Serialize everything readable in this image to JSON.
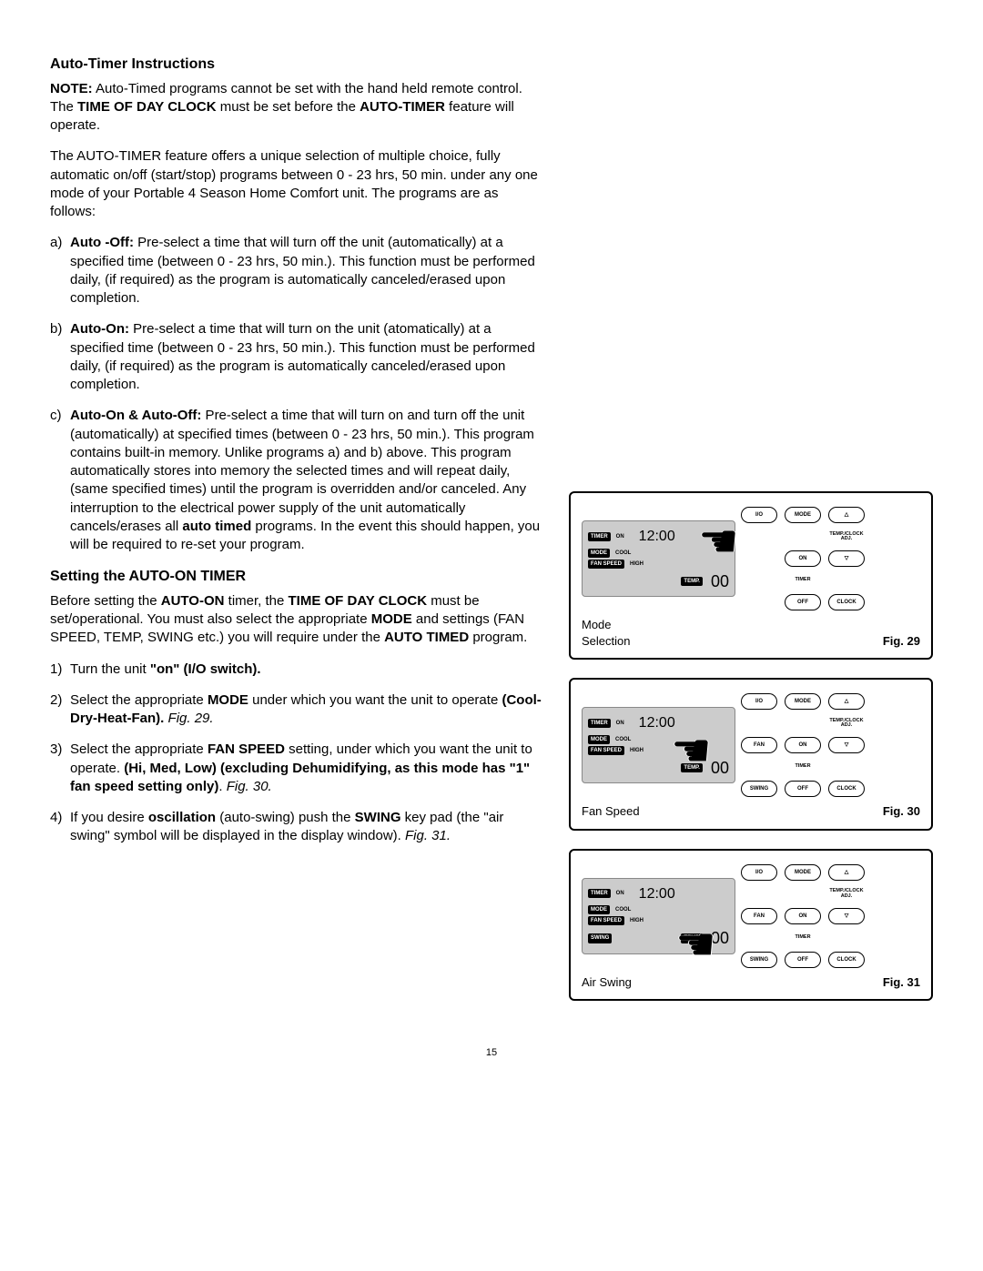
{
  "page_number": "15",
  "section1_title": "Auto-Timer Instructions",
  "note_prefix": "NOTE:",
  "note_text_1": "  Auto-Timed programs cannot be set with the hand held remote control.  The ",
  "note_bold_1": "TIME OF DAY CLOCK",
  "note_text_2": " must be set before the ",
  "note_bold_2": "AUTO-TIMER",
  "note_text_3": " feature will operate.",
  "intro": "The AUTO-TIMER feature offers a unique selection of multiple choice, fully automatic on/off (start/stop) programs between 0 - 23 hrs, 50 min. under any one mode of your Portable 4 Season Home Comfort unit.  The programs are as follows:",
  "a_marker": "a)",
  "a_bold": "Auto -Off:",
  "a_text": "  Pre-select a time that will turn off the unit (automatically) at a specified time (between 0 - 23 hrs, 50 min.).  This function must be performed daily, (if required) as the program is automatically canceled/erased upon completion.",
  "b_marker": "b)",
  "b_bold": "Auto-On:",
  "b_text": "  Pre-select a time that will turn on the unit (atomatically) at a specified time (between 0 - 23 hrs, 50 min.).  This function must be performed daily, (if required) as the program is automatically canceled/erased upon completion.",
  "c_marker": "c)",
  "c_bold_1": "Auto-On & Auto-Off:",
  "c_text_1": "  Pre-select a time that will turn on and turn off the unit (automatically) at specified times (between 0 - 23 hrs, 50 min.).  This program contains built-in memory.  Unlike programs a) and b) above.  This program automatically stores into memory the selected times and will repeat daily, (same specified times) until the program is overridden and/or canceled.  Any interruption to the electrical power supply of the unit automatically cancels/erases all ",
  "c_bold_2": "auto timed",
  "c_text_2": " programs.  In the event this should happen, you will be required to re-set your program.",
  "section2_title": "Setting the AUTO-ON TIMER",
  "s2_p1_1": "Before setting the ",
  "s2_p1_b1": "AUTO-ON",
  "s2_p1_2": " timer, the ",
  "s2_p1_b2": "TIME OF DAY CLOCK",
  "s2_p1_3": " must be set/operational.  You must also select the appropriate ",
  "s2_p1_b3": "MODE",
  "s2_p1_4": " and settings (FAN SPEED, TEMP, SWING etc.) you will require under the ",
  "s2_p1_b4": "AUTO TIMED",
  "s2_p1_5": " program.",
  "step1_marker": "1)",
  "step1_1": "Turn the unit ",
  "step1_b": "\"on\" (I/O switch).",
  "step2_marker": "2)",
  "step2_1": "Select the appropriate ",
  "step2_b1": "MODE",
  "step2_2": " under which you want the unit to operate ",
  "step2_b2": "(Cool-Dry-Heat-Fan).",
  "step2_fig": "Fig. 29.",
  "step3_marker": "3)",
  "step3_1": "Select the appropriate ",
  "step3_b1": "FAN SPEED",
  "step3_2": " setting, under which you want the unit to operate.  ",
  "step3_b2": "(Hi, Med, Low) (excluding Dehumidifying, as this mode has \"1\" fan speed setting only)",
  "step3_3": ".  ",
  "step3_fig": "Fig. 30.",
  "step4_marker": "4)",
  "step4_1": "If you desire ",
  "step4_b1": "oscillation",
  "step4_2": " (auto-swing) push the ",
  "step4_b2": "SWING",
  "step4_3": " key pad (the \"air swing\" symbol will be displayed in the display window).  ",
  "step4_fig": "Fig. 31.",
  "lcd": {
    "timer": "TIMER",
    "on": "ON",
    "mode": "MODE",
    "cool": "COOL",
    "fanspeed": "FAN SPEED",
    "high": "HIGH",
    "swing": "SWING",
    "temp": "TEMP.",
    "clock": "12:00",
    "value": "00"
  },
  "btns": {
    "io": "I/O",
    "mode": "MODE",
    "up": "△",
    "fan": "FAN",
    "on": "ON",
    "down": "▽",
    "swing": "SWING",
    "off": "OFF",
    "clock": "CLOCK",
    "adj": "TEMP./CLOCK ADJ.",
    "timer": "TIMER"
  },
  "fig29": {
    "left": "Mode\nSelection",
    "right": "Fig. 29"
  },
  "fig30": {
    "left": "Fan Speed",
    "right": "Fig. 30"
  },
  "fig31": {
    "left": "Air Swing",
    "right": "Fig. 31"
  }
}
